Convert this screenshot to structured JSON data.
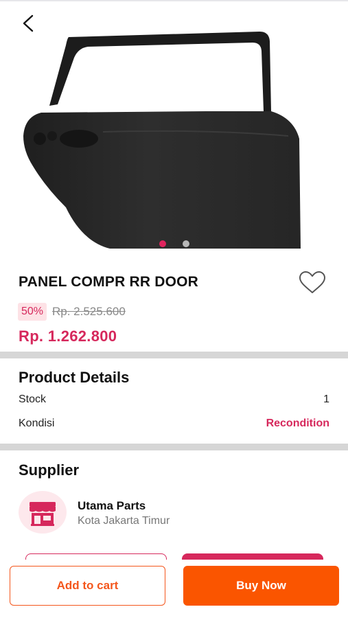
{
  "product": {
    "image_alt": "car-rear-door",
    "title": "PANEL COMPR RR DOOR",
    "discount": "50%",
    "original_price": "Rp. 2.525.600",
    "price": "Rp. 1.262.800",
    "image_pages": 2,
    "active_image": 1
  },
  "details": {
    "heading": "Product Details",
    "rows": [
      {
        "label": "Stock",
        "value": "1"
      },
      {
        "label": "Kondisi",
        "value": "Recondition"
      }
    ]
  },
  "supplier": {
    "heading": "Supplier",
    "name": "Utama Parts",
    "location": "Kota Jakarta Timur"
  },
  "actions": {
    "add_to_cart": "Add to cart",
    "buy_now": "Buy Now"
  },
  "colors": {
    "accent": "#d6285c",
    "buy": "#fa5500",
    "dot_active": "#e0245e",
    "dot_inactive": "#b8b8b8"
  },
  "icons": [
    "back-arrow-icon",
    "heart-icon",
    "store-icon"
  ]
}
